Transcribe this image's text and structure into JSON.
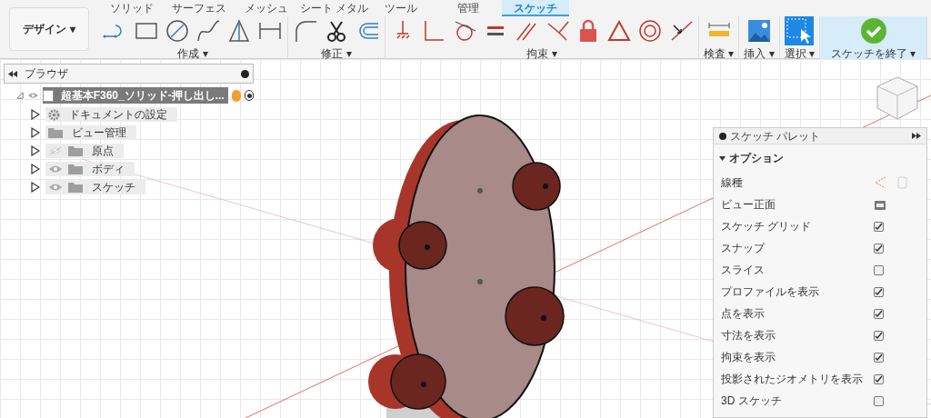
{
  "workspace_button": {
    "label": "デザイン ▾"
  },
  "tabs": [
    {
      "label": "ソリッド",
      "selected": false
    },
    {
      "label": "サーフェス",
      "selected": false
    },
    {
      "label": "メッシュ",
      "selected": false
    },
    {
      "label": "シート メタル",
      "selected": false
    },
    {
      "label": "ツール",
      "selected": false
    },
    {
      "label": "管理",
      "selected": false
    },
    {
      "label": "スケッチ",
      "selected": true
    }
  ],
  "tool_groups": [
    {
      "kind": "create",
      "label": "作成 ▾"
    },
    {
      "kind": "modify",
      "label": "修正 ▾"
    },
    {
      "kind": "constrain",
      "label": "拘束 ▾"
    },
    {
      "kind": "inspect",
      "label": "検査 ▾"
    },
    {
      "kind": "insert",
      "label": "挿入 ▾"
    },
    {
      "kind": "select",
      "label": "選択 ▾"
    },
    {
      "kind": "finish",
      "label": "スケッチを終了 ▾"
    }
  ],
  "browser": {
    "title": "ブラウザ",
    "root": {
      "label": "超基本F360_ソリッド-押し出し...",
      "expanded": true,
      "children": [
        {
          "label": "ドキュメントの設定",
          "kind": "settings"
        },
        {
          "label": "ビュー管理",
          "kind": "folder"
        },
        {
          "label": "原点",
          "kind": "hidden"
        },
        {
          "label": "ボディ",
          "kind": "shown"
        },
        {
          "label": "スケッチ",
          "kind": "shown"
        }
      ]
    }
  },
  "sketch_palette": {
    "title": "スケッチ パレット",
    "section": {
      "label": "オプション",
      "expanded": true
    },
    "options": [
      {
        "kind": "linetype",
        "label": "線種"
      },
      {
        "kind": "view",
        "label": "ビュー正面"
      },
      {
        "kind": "checkbox",
        "label": "スケッチ グリッド",
        "checked": true
      },
      {
        "kind": "checkbox",
        "label": "スナップ",
        "checked": true
      },
      {
        "kind": "checkbox",
        "label": "スライス",
        "checked": false
      },
      {
        "kind": "checkbox",
        "label": "プロファイルを表示",
        "checked": true
      },
      {
        "kind": "checkbox",
        "label": "点を表示",
        "checked": true
      },
      {
        "kind": "checkbox",
        "label": "寸法を表示",
        "checked": true
      },
      {
        "kind": "checkbox",
        "label": "拘束を表示",
        "checked": true
      },
      {
        "kind": "checkbox",
        "label": "投影されたジオメトリを表示",
        "checked": true
      },
      {
        "kind": "checkbox",
        "label": "3D スケッチ",
        "checked": false
      }
    ]
  }
}
